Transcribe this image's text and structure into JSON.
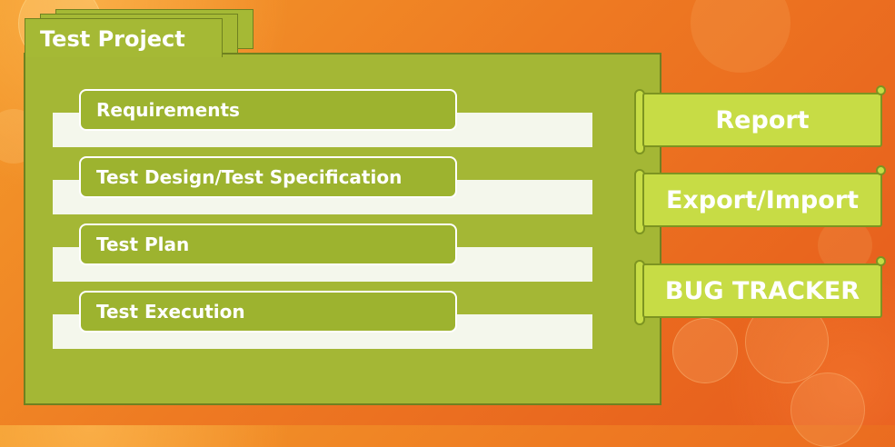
{
  "project": {
    "title": "Test Project"
  },
  "modules": [
    {
      "label": "Requirements"
    },
    {
      "label": "Test Design/Test Specification"
    },
    {
      "label": "Test Plan"
    },
    {
      "label": "Test Execution"
    }
  ],
  "actions": [
    {
      "label": "Report"
    },
    {
      "label": "Export/Import"
    },
    {
      "label": "BUG TRACKER"
    }
  ],
  "colors": {
    "panel": "#a4b735",
    "pill": "#9db32f",
    "scroll": "#c7dc45",
    "background": "#ee7a22"
  }
}
